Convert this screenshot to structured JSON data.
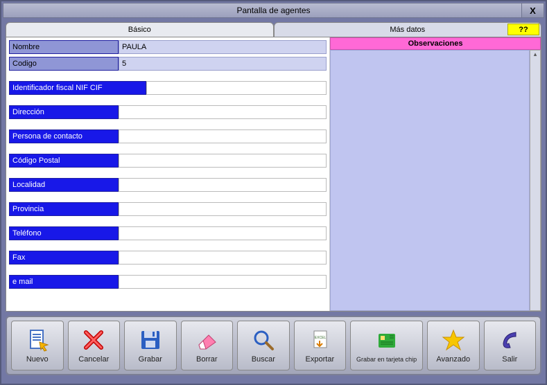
{
  "window": {
    "title": "Pantalla de agentes",
    "close_label": "X"
  },
  "tabs": {
    "basic": "Básico",
    "more": "Más datos",
    "help": "??"
  },
  "fields": {
    "nombre": {
      "label": "Nombre",
      "value": "PAULA"
    },
    "codigo": {
      "label": "Codigo",
      "value": "5"
    },
    "nif": {
      "label": "Identificador fiscal NIF CIF",
      "value": ""
    },
    "direccion": {
      "label": "Dirección",
      "value": ""
    },
    "contacto": {
      "label": "Persona de contacto",
      "value": ""
    },
    "cp": {
      "label": "Código Postal",
      "value": ""
    },
    "localidad": {
      "label": "Localidad",
      "value": ""
    },
    "provincia": {
      "label": "Provincia",
      "value": ""
    },
    "telefono": {
      "label": "Teléfono",
      "value": ""
    },
    "fax": {
      "label": "Fax",
      "value": ""
    },
    "email": {
      "label": "e mail",
      "value": ""
    }
  },
  "observaciones": {
    "header": "Observaciones",
    "text": ""
  },
  "toolbar": {
    "nuevo": "Nuevo",
    "cancelar": "Cancelar",
    "grabar": "Grabar",
    "borrar": "Borrar",
    "buscar": "Buscar",
    "exportar": "Exportar",
    "chip": "Grabar en tarjeta chip",
    "avanzado": "Avanzado",
    "salir": "Salir"
  }
}
